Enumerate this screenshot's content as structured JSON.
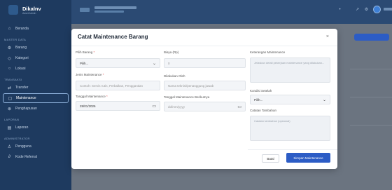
{
  "brand": {
    "name": "Dikalnv",
    "subtitle": "Asset Admin"
  },
  "sidebar": {
    "items": [
      {
        "label": "Beranda",
        "icon": "home-icon"
      },
      {
        "section": "MASTER DATA"
      },
      {
        "label": "Barang",
        "icon": "gear-icon"
      },
      {
        "label": "Kategori",
        "icon": "tag-icon"
      },
      {
        "label": "Lokasi",
        "icon": "location-icon"
      },
      {
        "section": "TRANSAKSI"
      },
      {
        "label": "Transfer",
        "icon": "transfer-icon"
      },
      {
        "label": "Maintenance",
        "icon": "wrench-icon",
        "active": true
      },
      {
        "label": "Penghapusan",
        "icon": "delete-icon"
      },
      {
        "section": "LAPORAN"
      },
      {
        "label": "Laporan",
        "icon": "report-icon"
      },
      {
        "section": "ADMINISTRATOR"
      },
      {
        "label": "Pengguna",
        "icon": "users-icon"
      },
      {
        "label": "Kode Referral",
        "icon": "link-icon"
      }
    ]
  },
  "modal": {
    "title": "Catat Maintenance Barang",
    "close": "×",
    "fields": {
      "pilih_barang": {
        "label": "Pilih Barang",
        "required": "*",
        "value": "Pilih..."
      },
      "jenis_maintenance": {
        "label": "Jenis Maintenance",
        "required": "*",
        "placeholder": "Contoh: Servis rutin, Perbaikan, Penggantian"
      },
      "tanggal_maintenance": {
        "label": "Tanggal Maintenance",
        "required": "*",
        "value": "28/01/2026"
      },
      "biaya": {
        "label": "Biaya (Rp)",
        "placeholder": "0"
      },
      "dilakukan_oleh": {
        "label": "Dilakukan Oleh",
        "placeholder": "Nama teknisi/penanggung jawab"
      },
      "tanggal_berikutnya": {
        "label": "Tanggal Maintenance Berikutnya",
        "placeholder": "dd/mm/yyyy"
      },
      "keterangan": {
        "label": "Keterangan Maintenance",
        "placeholder": "Jelaskan detail pekerjaan maintenance yang dilakukan..."
      },
      "kondisi_setelah": {
        "label": "Kondisi Setelah",
        "value": "Pilih..."
      },
      "catatan_tambahan": {
        "label": "Catatan Tambahan",
        "placeholder": "Catatan tambahan (opsional)"
      }
    },
    "buttons": {
      "cancel": "Batal",
      "save": "Simpan Maintenance"
    }
  },
  "icons": {
    "calendar": "calendar-icon",
    "select": "chevron-down-icon"
  },
  "colors": {
    "sidebar": "#1e3a5f",
    "primary": "#2c5cc5",
    "required": "#e05252"
  }
}
